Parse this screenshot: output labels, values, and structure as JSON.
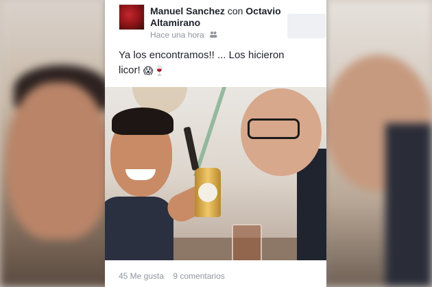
{
  "post": {
    "author": "Manuel Sanchez",
    "with_word": "con",
    "tagged": "Octavio Altamirano",
    "time": "Hace una hora",
    "privacy_icon": "friends-icon",
    "status_line1": "Ya los encontramos!! ...  Los hicieron",
    "status_line2": "licor!",
    "emoji1": "😱",
    "emoji2": "🍷",
    "likes": "45 Me gusta",
    "comments": "9 comentarios"
  },
  "colors": {
    "name_text": "#1d2129",
    "meta_text": "#90949c",
    "card_bg": "#ffffff"
  }
}
